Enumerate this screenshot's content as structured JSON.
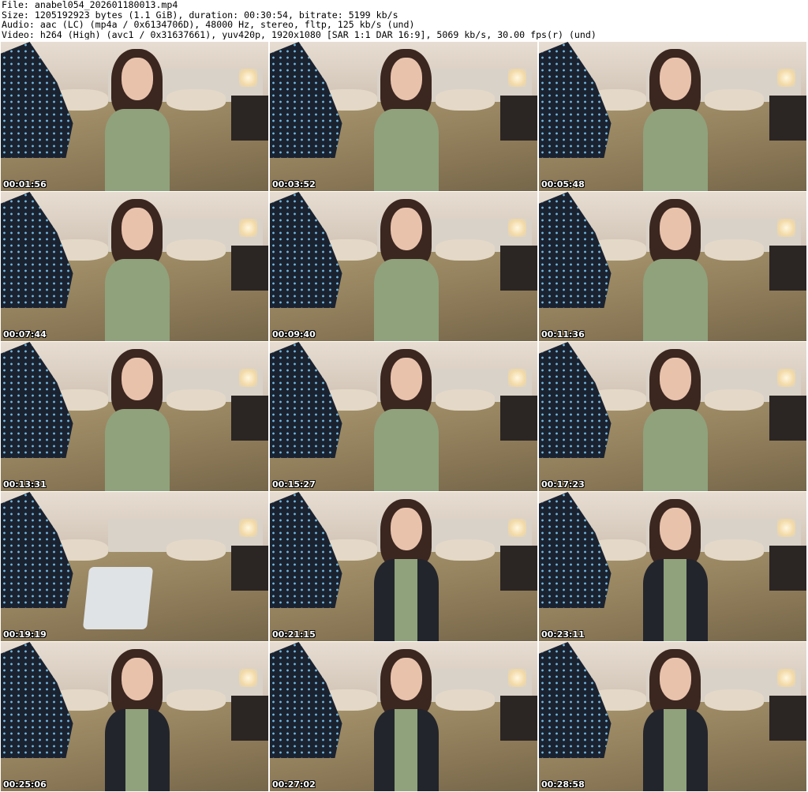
{
  "file_info": {
    "file": "File: anabel054_202601180013.mp4",
    "size": "Size: 1205192923 bytes (1.1 GiB), duration: 00:30:54, bitrate: 5199 kb/s",
    "audio": "Audio: aac (LC) (mp4a / 0x6134706D), 48000 Hz, stereo, fltp, 125 kb/s (und)",
    "video": "Video: h264 (High) (avc1 / 0x31637661), yuv420p, 1920x1080 [SAR 1:1 DAR 16:9], 5069 kb/s, 30.00 fps(r) (und)"
  },
  "thumbnails": [
    {
      "timestamp": "00:01:56",
      "variant": "tank"
    },
    {
      "timestamp": "00:03:52",
      "variant": "tank"
    },
    {
      "timestamp": "00:05:48",
      "variant": "tank"
    },
    {
      "timestamp": "00:07:44",
      "variant": "tank"
    },
    {
      "timestamp": "00:09:40",
      "variant": "tank"
    },
    {
      "timestamp": "00:11:36",
      "variant": "tank"
    },
    {
      "timestamp": "00:13:31",
      "variant": "tank"
    },
    {
      "timestamp": "00:15:27",
      "variant": "tank"
    },
    {
      "timestamp": "00:17:23",
      "variant": "tank"
    },
    {
      "timestamp": "00:19:19",
      "variant": "chair"
    },
    {
      "timestamp": "00:21:15",
      "variant": "hoodie"
    },
    {
      "timestamp": "00:23:11",
      "variant": "hoodie"
    },
    {
      "timestamp": "00:25:06",
      "variant": "hoodie"
    },
    {
      "timestamp": "00:27:02",
      "variant": "hoodie"
    },
    {
      "timestamp": "00:28:58",
      "variant": "hoodie"
    }
  ]
}
